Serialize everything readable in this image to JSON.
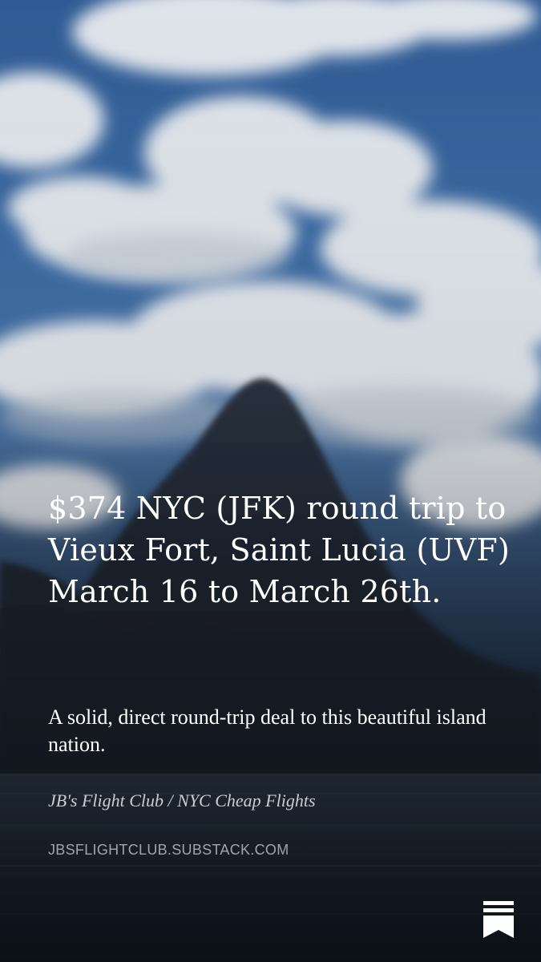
{
  "post": {
    "headline": "$374 NYC (JFK) round trip to Vieux Fort, Saint Lucia (UVF) March 16 to March 26th.",
    "subtitle": "A solid, direct round-trip deal to this beautiful island nation.",
    "publication": "JB's Flight Club / NYC Cheap Flights",
    "domain": "JBSFLIGHTCLUB.SUBSTACK.COM"
  },
  "icons": {
    "logo": "substack-logo-icon",
    "background": "mountain-photo"
  },
  "colors": {
    "text_primary": "#ffffff",
    "text_publication": "#c9cdd3",
    "text_domain": "#9ea5ae",
    "sky": "#3b6aa3"
  }
}
